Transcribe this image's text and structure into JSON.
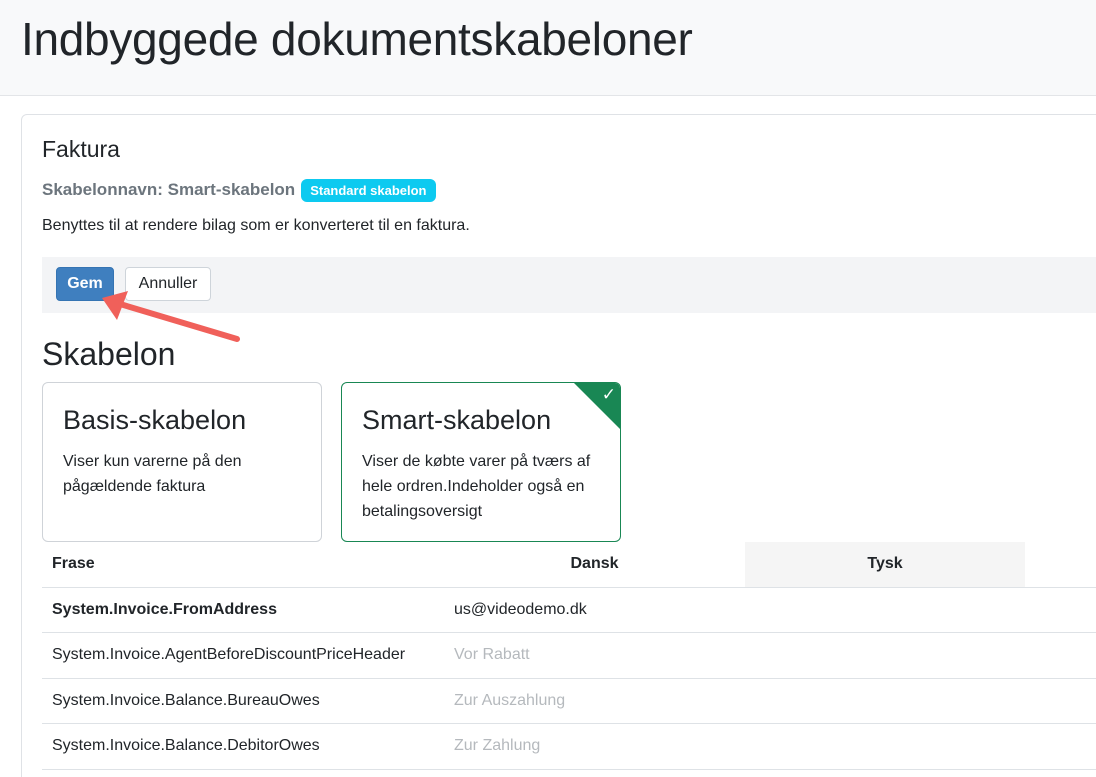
{
  "header": {
    "title": "Indbyggede dokumentskabeloner"
  },
  "card": {
    "title": "Faktura",
    "template_name_label": "Skabelonnavn: Smart-skabelon",
    "default_badge": "Standard skabelon",
    "description": "Benyttes til at rendere bilag som er konverteret til en faktura."
  },
  "toolbar": {
    "save_label": "Gem",
    "cancel_label": "Annuller"
  },
  "template_section": {
    "heading": "Skabelon",
    "options": [
      {
        "title": "Basis-skabelon",
        "description": "Viser kun varerne på den pågældende faktura",
        "selected": false
      },
      {
        "title": "Smart-skabelon",
        "description": "Viser de købte varer på tværs af hele ordren.Indeholder også en betalingsoversigt",
        "selected": true
      }
    ],
    "check_icon": "✓"
  },
  "table": {
    "headers": {
      "phrase": "Frase",
      "danish": "Dansk",
      "german": "Tysk"
    },
    "rows": [
      {
        "phrase": "System.Invoice.FromAddress",
        "danish": "us@videodemo.dk",
        "danish_placeholder": false,
        "bold": true
      },
      {
        "phrase": "System.Invoice.AgentBeforeDiscountPriceHeader",
        "danish": "Vor Rabatt",
        "danish_placeholder": true,
        "bold": false
      },
      {
        "phrase": "System.Invoice.Balance.BureauOwes",
        "danish": "Zur Auszahlung",
        "danish_placeholder": true,
        "bold": false
      },
      {
        "phrase": "System.Invoice.Balance.DebitorOwes",
        "danish": "Zur Zahlung",
        "danish_placeholder": true,
        "bold": false
      }
    ]
  },
  "colors": {
    "primary": "#3f7fbf",
    "badge": "#0dcaf0",
    "success": "#198754",
    "annotation_arrow": "#f0605a"
  }
}
